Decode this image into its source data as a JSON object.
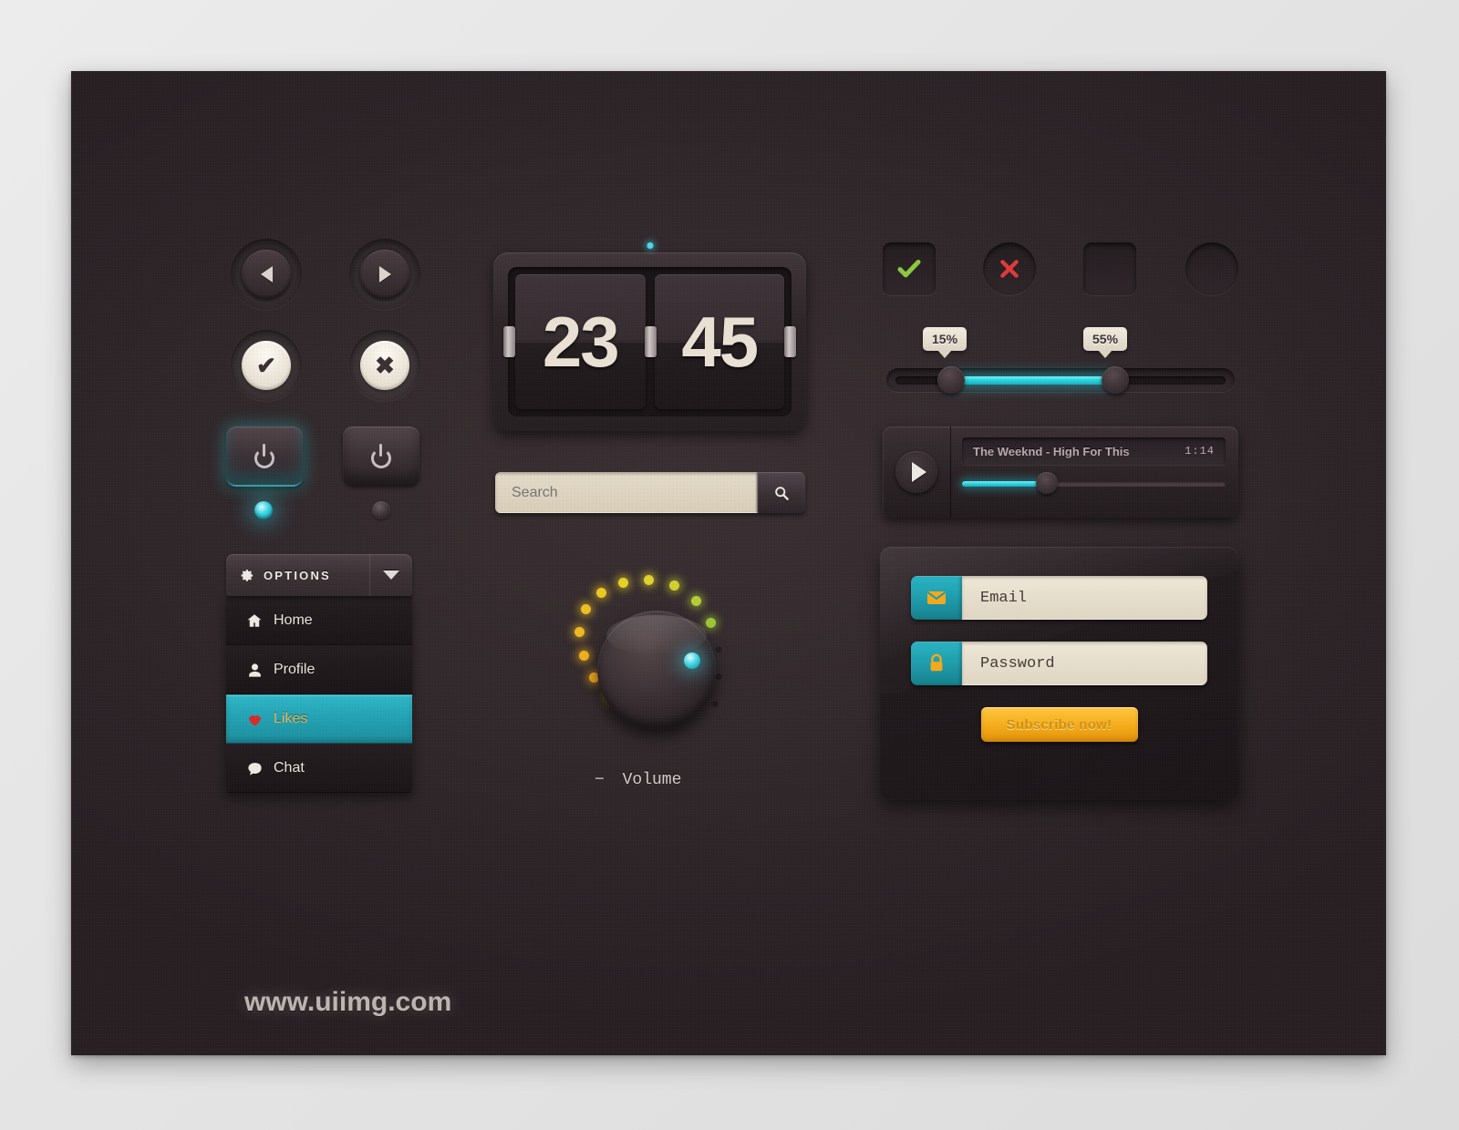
{
  "watermark": "www.uiimg.com",
  "nav_buttons": [
    {
      "name": "prev",
      "icon": "triangle-left-icon"
    },
    {
      "name": "next",
      "icon": "triangle-right-icon"
    },
    {
      "name": "accept",
      "icon": "check-icon",
      "glyph": "✔"
    },
    {
      "name": "reject",
      "icon": "cross-icon",
      "glyph": "✖"
    }
  ],
  "power": {
    "on_label": "power-on",
    "off_label": "power-off",
    "led_on": "#3ed4e2",
    "led_off": "#3a3034"
  },
  "dropdown": {
    "header": "OPTIONS",
    "items": [
      {
        "label": "Home",
        "icon": "home-icon",
        "active": false
      },
      {
        "label": "Profile",
        "icon": "user-icon",
        "active": false
      },
      {
        "label": "Likes",
        "icon": "heart-icon",
        "active": true
      },
      {
        "label": "Chat",
        "icon": "chat-bubble-icon",
        "active": false
      }
    ],
    "active_bg": "#23a3b4",
    "active_text": "#e9b659"
  },
  "clock": {
    "hours": "23",
    "minutes": "45",
    "led_color": "#4fd8e4"
  },
  "search": {
    "placeholder": "Search",
    "value": "",
    "button_icon": "search-icon"
  },
  "volume": {
    "label": "Volume",
    "minus": "−",
    "lit_leds": 10,
    "total_leds": 13,
    "indicator_color": "#3ed4e2"
  },
  "toggles": [
    {
      "name": "checkbox-checked",
      "shape": "square",
      "icon": "check-icon",
      "glyph": "✔",
      "color": "#8cc63f",
      "checked": true
    },
    {
      "name": "radio-rejected",
      "shape": "circle",
      "icon": "cross-icon",
      "glyph": "✖",
      "color": "#e03a3a",
      "checked": true
    },
    {
      "name": "checkbox-empty",
      "shape": "square",
      "icon": "",
      "glyph": "",
      "color": "",
      "checked": false
    },
    {
      "name": "radio-empty",
      "shape": "circle",
      "icon": "",
      "glyph": "",
      "color": "",
      "checked": false
    }
  ],
  "range_slider": {
    "min_tooltip": "15%",
    "max_tooltip": "55%",
    "min_value": 15,
    "max_value": 55,
    "fill_color": "#2bd0dd"
  },
  "player": {
    "play_icon": "play-icon",
    "track": "The Weeknd - High For This",
    "time": "1:14",
    "progress_percent": 30,
    "fill_color": "#2acfdc"
  },
  "signup": {
    "email": {
      "placeholder": "Email",
      "value": "Email",
      "icon": "envelope-icon"
    },
    "password": {
      "placeholder": "Password",
      "value": "Password",
      "icon": "lock-icon"
    },
    "button": "Subscribe now!",
    "button_color": "#f5ad1d",
    "icon_box_color": "#1f9aa9"
  },
  "colors": {
    "panel_bg": "#2e2427",
    "page_bg": "#e7e7e7",
    "accent_teal": "#2bd0dd",
    "accent_orange": "#f5ad1d",
    "cream": "#e4dbc9"
  }
}
